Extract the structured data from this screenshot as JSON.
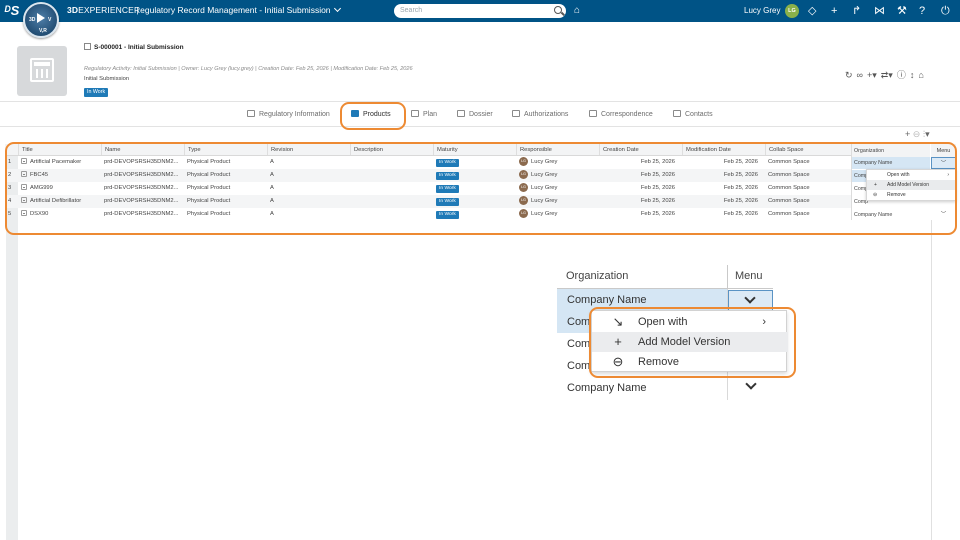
{
  "topbar": {
    "compass_top": "3D",
    "compass_mid": "V",
    "compass_bottom": "V,R",
    "brand_bold": "3D",
    "brand_light": "EXPERIENCE |",
    "app_title": "Regulatory Record Management - Initial Submission",
    "search_placeholder": "Search",
    "user_name": "Lucy Grey",
    "user_initials": "LG"
  },
  "object": {
    "title": "S-000001 - Initial Submission",
    "meta": "Regulatory Activity: Initial Submission  |  Owner: Lucy Grey (lucy.grey)  |  Creation Date: Feb 25, 2026  |  Modification Date: Feb 25, 2026",
    "subname": "Initial Submission",
    "state": "In Work"
  },
  "tabs": [
    {
      "label": "Regulatory Information"
    },
    {
      "label": "Products"
    },
    {
      "label": "Plan"
    },
    {
      "label": "Dossier"
    },
    {
      "label": "Authorizations"
    },
    {
      "label": "Correspondence"
    },
    {
      "label": "Contacts"
    }
  ],
  "table": {
    "headers": [
      "Title",
      "Name",
      "Type",
      "Revision",
      "Description",
      "Maturity",
      "Responsible",
      "Creation Date",
      "Modification Date",
      "Collab Space",
      "Organization",
      "Menu"
    ],
    "rows": [
      {
        "n": "1",
        "title": "Artificial Pacemaker",
        "name": "prd-DEVOPSRSH35DNM2...",
        "type": "Physical Product",
        "rev": "A",
        "maturity": "In Work",
        "resp": "Lucy Grey",
        "initials": "LG",
        "created": "Feb 25, 2026",
        "modified": "Feb 25, 2026",
        "space": "Common Space",
        "org": "Company Name"
      },
      {
        "n": "2",
        "title": "FBC45",
        "name": "prd-DEVOPSRSH35DNM2...",
        "type": "Physical Product",
        "rev": "A",
        "maturity": "In Work",
        "resp": "Lucy Grey",
        "initials": "LG",
        "created": "Feb 25, 2026",
        "modified": "Feb 25, 2026",
        "space": "Common Space",
        "org": "Comp"
      },
      {
        "n": "3",
        "title": "AMG999",
        "name": "prd-DEVOPSRSH35DNM2...",
        "type": "Physical Product",
        "rev": "A",
        "maturity": "In Work",
        "resp": "Lucy Grey",
        "initials": "LG",
        "created": "Feb 25, 2026",
        "modified": "Feb 25, 2026",
        "space": "Common Space",
        "org": "Comp"
      },
      {
        "n": "4",
        "title": "Artificial Defibrillator",
        "name": "prd-DEVOPSRSH35DNM2...",
        "type": "Physical Product",
        "rev": "A",
        "maturity": "In Work",
        "resp": "Lucy Grey",
        "initials": "LG",
        "created": "Feb 25, 2026",
        "modified": "Feb 25, 2026",
        "space": "Common Space",
        "org": "Comp"
      },
      {
        "n": "5",
        "title": "DSX90",
        "name": "prd-DEVOPSRSH35DNM2...",
        "type": "Physical Product",
        "rev": "A",
        "maturity": "In Work",
        "resp": "Lucy Grey",
        "initials": "LG",
        "created": "Feb 25, 2026",
        "modified": "Feb 25, 2026",
        "space": "Common Space",
        "org": "Company Name"
      }
    ]
  },
  "context_menu": {
    "items": [
      {
        "label": "Open with",
        "icon": "open-with-icon"
      },
      {
        "label": "Add Model Version",
        "icon": "plus-icon"
      },
      {
        "label": "Remove",
        "icon": "minus-circle-icon"
      }
    ]
  },
  "zoom": {
    "col_org": "Organization",
    "col_menu": "Menu",
    "rows": [
      "Company Name",
      "Comp",
      "Comp",
      "Comp",
      "Company Name"
    ]
  },
  "colors": {
    "brand": "#005386",
    "accent": "#1f7ab7",
    "highlight": "#ed8a33"
  }
}
